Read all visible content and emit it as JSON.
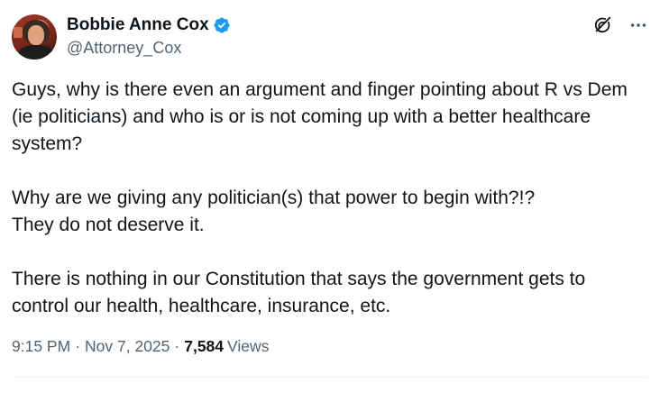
{
  "author": {
    "display_name": "Bobbie Anne Cox",
    "handle": "@Attorney_Cox",
    "verified": true
  },
  "tweet": {
    "text": "Guys, why is there even an argument and finger pointing about R vs Dem\n(ie politicians) and who is or is not coming up with a better healthcare\nsystem?\n\nWhy are we giving any politician(s) that power to begin with?!?\nThey do not deserve it.\n\nThere is nothing in our Constitution that says the government gets to\ncontrol our health, healthcare, insurance, etc."
  },
  "meta": {
    "time": "9:15 PM",
    "separator": "·",
    "date": "Nov 7, 2025",
    "views_count": "7,584",
    "views_label": "Views"
  },
  "icons": {
    "grok": "grok-icon",
    "more": "more-icon",
    "verified": "verified-badge-icon"
  },
  "colors": {
    "verified": "#1d9bf0",
    "text_primary": "#0f1419",
    "text_secondary": "#536471",
    "divider": "#eff3f4"
  }
}
